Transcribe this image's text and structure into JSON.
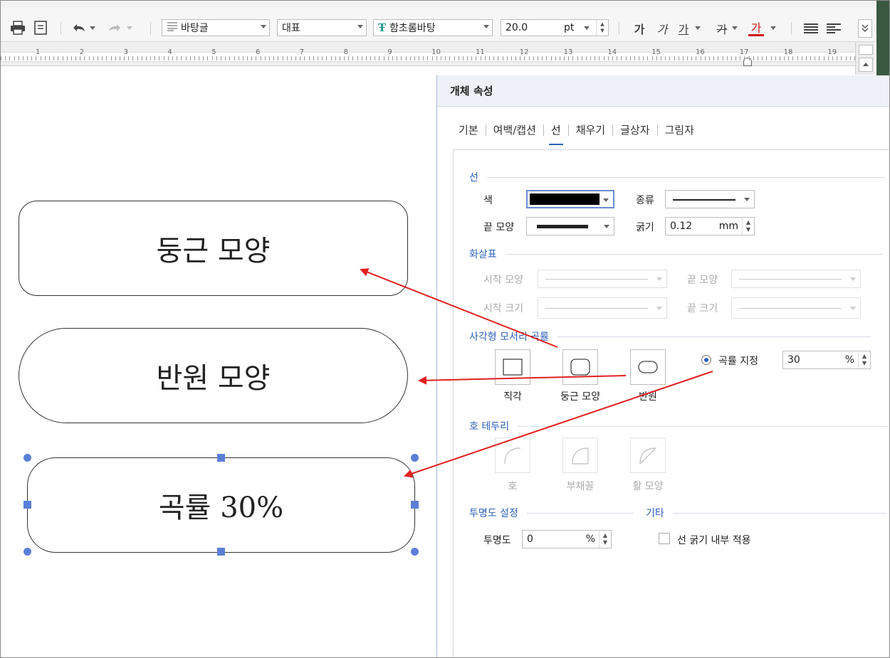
{
  "toolbar": {
    "style_value": "바탕글",
    "lang_value": "대표",
    "font_value": "함초롬바탕",
    "size_value": "20.0",
    "size_unit": "pt",
    "bold_glyph": "가",
    "italic_glyph": "가",
    "underline_glyph": "가",
    "strike_glyph": "가",
    "color_glyph": "가"
  },
  "ruler": {
    "numbers": [
      "1",
      "2",
      "3",
      "4",
      "5",
      "6",
      "7",
      "8",
      "9",
      "10",
      "11",
      "12",
      "13",
      "14",
      "15",
      "16",
      "17",
      "18",
      "19"
    ]
  },
  "document": {
    "shapes": [
      {
        "label": "둥근 모양"
      },
      {
        "label": "반원 모양"
      },
      {
        "label": "곡률 30%"
      }
    ]
  },
  "dialog": {
    "title": "개체 속성",
    "tabs": [
      "기본",
      "여백/캡션",
      "선",
      "채우기",
      "글상자",
      "그림자"
    ],
    "active_tab": "선",
    "line": {
      "section": "선",
      "color_label": "색",
      "color_value": "#000000",
      "type_label": "종류",
      "end_label": "끝 모양",
      "width_label": "굵기",
      "width_value": "0.12",
      "width_unit": "mm"
    },
    "arrow": {
      "section": "화살표",
      "start_shape_label": "시작 모양",
      "end_shape_label": "끝 모양",
      "start_size_label": "시작 크기",
      "end_size_label": "끝 크기"
    },
    "corner": {
      "section": "사각형 모서리 곡률",
      "options": [
        "직각",
        "둥근 모양",
        "반원"
      ],
      "custom_label": "곡률 지정",
      "custom_value": "30",
      "custom_unit": "%"
    },
    "arc": {
      "section": "호 테두리",
      "options": [
        "호",
        "부채꼴",
        "활 모양"
      ]
    },
    "transparency": {
      "section": "투명도 설정",
      "label": "투명도",
      "value": "0",
      "unit": "%"
    },
    "etc": {
      "section": "기타",
      "inner_width_label": "선 굵기 내부 적용"
    }
  },
  "colors": {
    "accent": "#2d5fb8",
    "handle": "#5b7fd6",
    "annotation_arrow": "#e02020"
  }
}
